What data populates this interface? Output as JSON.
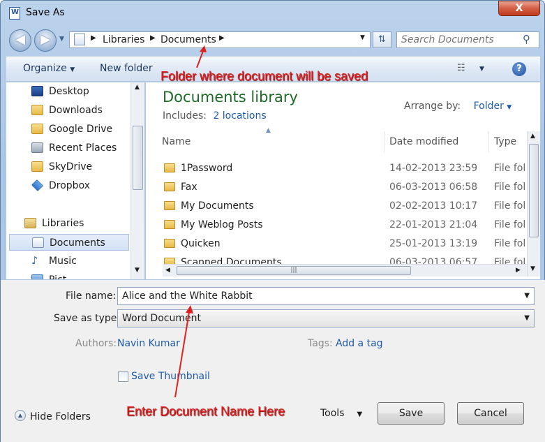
{
  "window": {
    "title": "Save As",
    "close_glyph": "X"
  },
  "nav": {
    "back_icon": "back-arrow-icon",
    "forward_icon": "forward-arrow-icon",
    "breadcrumb": [
      "Libraries",
      "Documents"
    ],
    "search_placeholder": "Search Documents"
  },
  "toolbar": {
    "organize": "Organize",
    "new_folder": "New folder"
  },
  "sidebar": {
    "favorites": [
      {
        "label": "Desktop",
        "icon": "desktop-icon"
      },
      {
        "label": "Downloads",
        "icon": "folder-icon"
      },
      {
        "label": "Google Drive",
        "icon": "folder-icon"
      },
      {
        "label": "Recent Places",
        "icon": "recent-places-icon"
      },
      {
        "label": "SkyDrive",
        "icon": "folder-icon"
      },
      {
        "label": "Dropbox",
        "icon": "dropbox-icon"
      }
    ],
    "libraries_label": "Libraries",
    "libraries": [
      {
        "label": "Documents",
        "icon": "documents-icon",
        "selected": true
      },
      {
        "label": "Music",
        "icon": "music-icon"
      },
      {
        "label": "Pict",
        "icon": "pictures-icon"
      }
    ]
  },
  "library": {
    "title": "Documents library",
    "includes_label": "Includes:",
    "includes_link": "2 locations",
    "arrange_label": "Arrange by:",
    "arrange_value": "Folder"
  },
  "columns": {
    "name": "Name",
    "date": "Date modified",
    "type": "Type"
  },
  "files": [
    {
      "name": "1Password",
      "date": "14-02-2013 23:59",
      "type": "File fol"
    },
    {
      "name": "Fax",
      "date": "06-03-2013 06:58",
      "type": "File fol"
    },
    {
      "name": "My Documents",
      "date": "02-02-2013 10:17",
      "type": "File fol"
    },
    {
      "name": "My Weblog Posts",
      "date": "22-01-2013 21:04",
      "type": "File fol"
    },
    {
      "name": "Quicken",
      "date": "25-01-2013 13:19",
      "type": "File fol"
    },
    {
      "name": "Scanned Documents",
      "date": "06-03-2013 06:57",
      "type": "File fol"
    }
  ],
  "form": {
    "file_name_label": "File name:",
    "file_name_value": "Alice and the White Rabbit",
    "save_type_label": "Save as type:",
    "save_type_value": "Word Document",
    "authors_label": "Authors:",
    "authors_value": "Navin Kumar",
    "tags_label": "Tags:",
    "tags_value": "Add a tag",
    "thumbnail_label": "Save Thumbnail"
  },
  "footer": {
    "hide_folders": "Hide Folders",
    "tools": "Tools",
    "save": "Save",
    "cancel": "Cancel"
  },
  "annotations": {
    "folder_note": "Folder where document will be saved",
    "name_note": "Enter Document Name Here",
    "color": "#e02020"
  }
}
